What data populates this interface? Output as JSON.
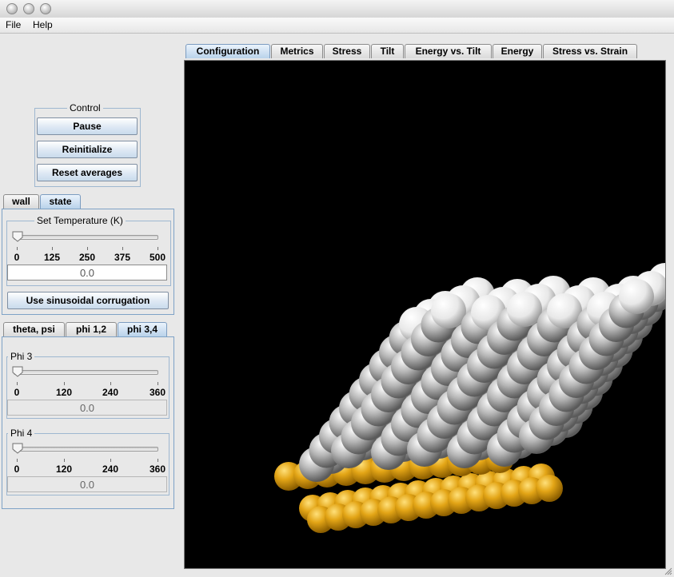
{
  "menu": {
    "file": "File",
    "help": "Help"
  },
  "control": {
    "title": "Control",
    "pause": "Pause",
    "reinitialize": "Reinitialize",
    "reset": "Reset averages"
  },
  "left_tabs": [
    "wall",
    "state"
  ],
  "state": {
    "temp_title": "Set Temperature (K)",
    "temp_ticks": [
      "0",
      "125",
      "250",
      "375",
      "500"
    ],
    "temp_value": "0.0",
    "temp_fraction": 0.0,
    "sinusoidal": "Use sinusoidal corrugation"
  },
  "angle_tabs": [
    "theta, psi",
    "phi 1,2",
    "phi 3,4"
  ],
  "phi3": {
    "title": "Phi 3",
    "ticks": [
      "0",
      "120",
      "240",
      "360"
    ],
    "value": "0.0",
    "fraction": 0.0
  },
  "phi4": {
    "title": "Phi 4",
    "ticks": [
      "0",
      "120",
      "240",
      "360"
    ],
    "value": "0.0",
    "fraction": 0.0
  },
  "main_tabs": [
    "Configuration",
    "Metrics",
    "Stress",
    "Tilt",
    "Energy vs. Tilt",
    "Energy",
    "Stress vs. Strain"
  ],
  "colors": {
    "substrate": "#e3a516",
    "molecule": "#b0b0b0",
    "molecule_top": "#f4f4f4",
    "background": "#000000"
  }
}
